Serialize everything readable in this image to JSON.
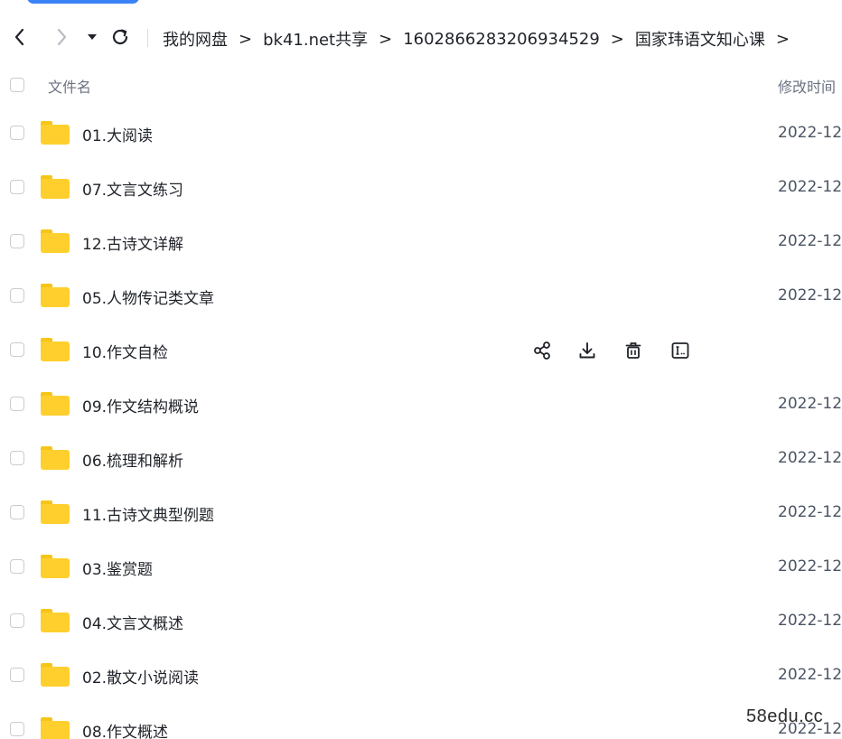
{
  "nav": {
    "back_icon": "chevron-left-icon",
    "forward_icon": "chevron-right-icon",
    "history_icon": "caret-down-icon",
    "refresh_icon": "refresh-icon"
  },
  "breadcrumb": {
    "items": [
      {
        "label": "我的网盘"
      },
      {
        "label": "bk41.net共享"
      },
      {
        "label": "1602866283206934529"
      },
      {
        "label": "国家玮语文知心课"
      }
    ],
    "separator": ">"
  },
  "table": {
    "header": {
      "name": "文件名",
      "modified": "修改时间"
    },
    "rows": [
      {
        "name": "01.大阅读",
        "modified": "2022-12"
      },
      {
        "name": "07.文言文练习",
        "modified": "2022-12"
      },
      {
        "name": "12.古诗文详解",
        "modified": "2022-12"
      },
      {
        "name": "05.人物传记类文章",
        "modified": "2022-12"
      },
      {
        "name": "10.作文自检",
        "modified": ""
      },
      {
        "name": "09.作文结构概说",
        "modified": "2022-12"
      },
      {
        "name": "06.梳理和解析",
        "modified": "2022-12"
      },
      {
        "name": "11.古诗文典型例题",
        "modified": "2022-12"
      },
      {
        "name": "03.鉴赏题",
        "modified": "2022-12"
      },
      {
        "name": "04.文言文概述",
        "modified": "2022-12"
      },
      {
        "name": "02.散文小说阅读",
        "modified": "2022-12"
      },
      {
        "name": "08.作文概述",
        "modified": "2022-12"
      }
    ]
  },
  "row_actions": {
    "icons": [
      "share-icon",
      "download-icon",
      "delete-icon",
      "rename-icon"
    ]
  },
  "watermark": "58edu.cc",
  "colors": {
    "folder": "#ffcf2d",
    "folder_tab": "#f5c518",
    "accent": "#3b82f6",
    "text": "#1f2329",
    "muted": "#6b7280"
  }
}
